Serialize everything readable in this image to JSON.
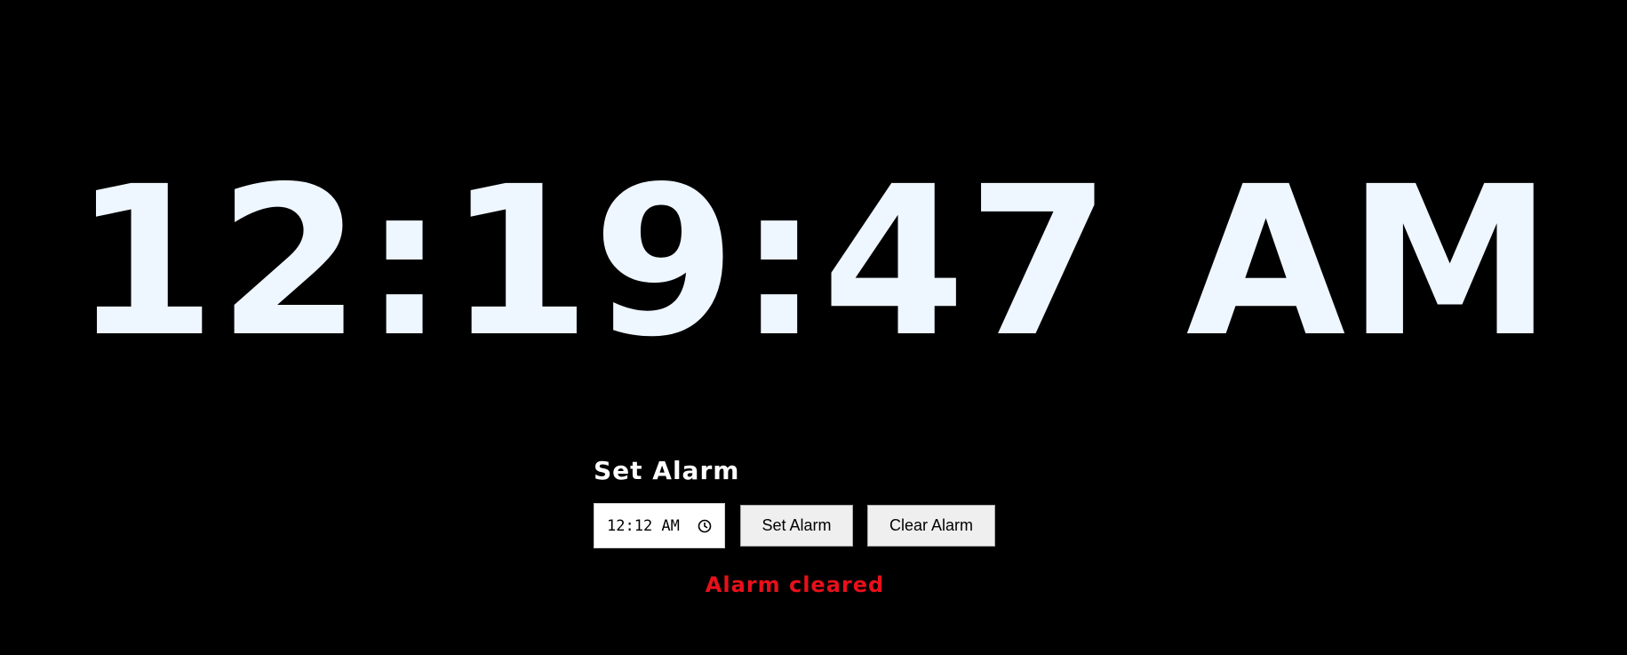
{
  "clock": {
    "time_display": "12:19:47 AM"
  },
  "alarm": {
    "heading": "Set Alarm",
    "time_input_value": "12:12 AM",
    "set_button_label": "Set Alarm",
    "clear_button_label": "Clear Alarm",
    "status_message": "Alarm cleared"
  },
  "icons": {
    "time_picker": "clock-icon"
  },
  "colors": {
    "background": "#000000",
    "clock_text": "#eef6ff",
    "status_text": "#e8101a"
  }
}
